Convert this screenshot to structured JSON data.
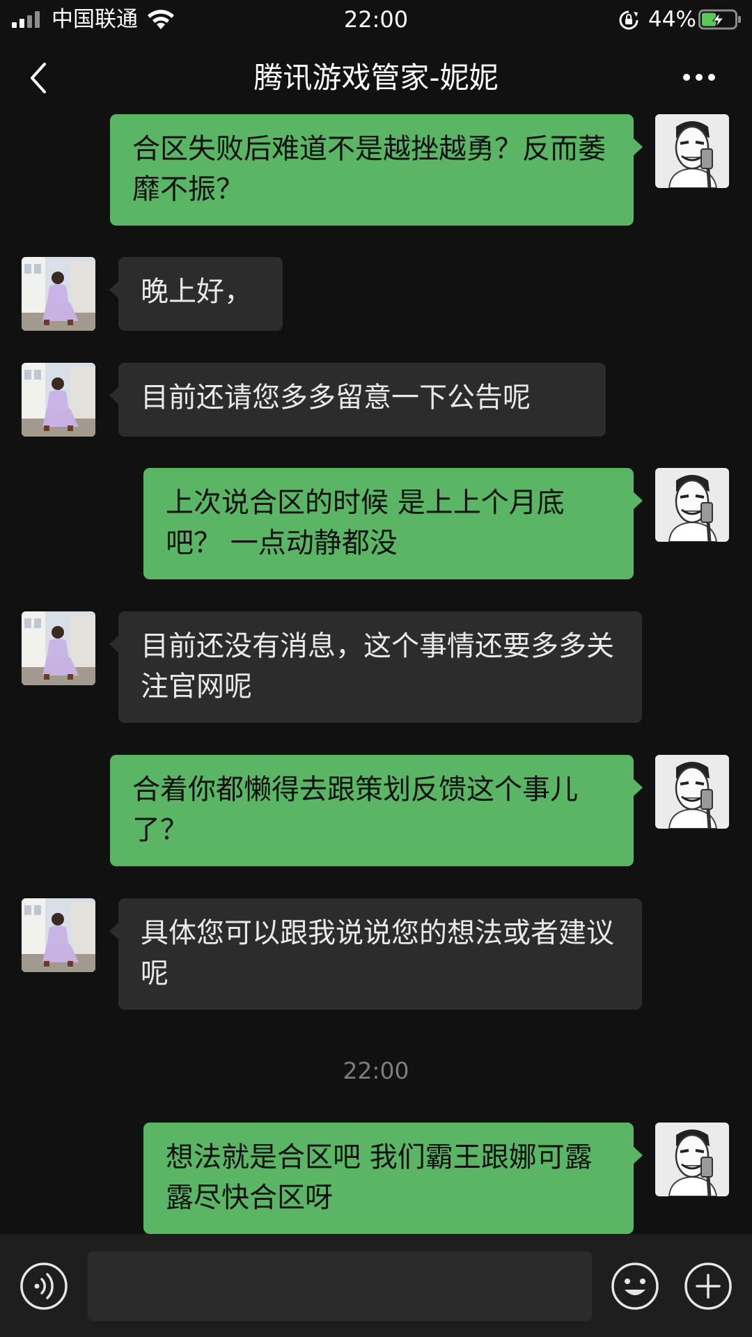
{
  "status_bar": {
    "carrier": "中国联通",
    "time": "22:00",
    "battery_percent": "44%",
    "battery_level": 0.44,
    "icons": [
      "signal-icon",
      "wifi-icon",
      "rotation-lock-icon",
      "battery-charging-icon"
    ]
  },
  "nav": {
    "title": "腾讯游戏管家-妮妮",
    "back_icon": "chevron-left-icon",
    "more_icon": "more-dots-icon"
  },
  "messages": [
    {
      "sender": "me",
      "text": "合区失败后难道不是越挫越勇？反而萎靡不振？"
    },
    {
      "sender": "them",
      "text": "晚上好，"
    },
    {
      "sender": "them",
      "text": "目前还请您多多留意一下公告呢"
    },
    {
      "sender": "me",
      "text": "上次说合区的时候 是上上个月底吧？ 一点动静都没"
    },
    {
      "sender": "them",
      "text": "目前还没有消息，这个事情还要多多关注官网呢"
    },
    {
      "sender": "me",
      "text": "合着你都懒得去跟策划反馈这个事儿了？"
    },
    {
      "sender": "them",
      "text": "具体您可以跟我说说您的想法或者建议呢"
    },
    {
      "sender": "me",
      "text": "想法就是合区吧 我们霸王跟娜可露露尽快合区呀"
    }
  ],
  "time_separator": "22:00",
  "input_bar": {
    "value": "",
    "voice_icon": "voice-icon",
    "emoji_icon": "emoji-icon",
    "plus_icon": "plus-icon"
  },
  "colors": {
    "background": "#111111",
    "my_bubble": "#5ab564",
    "their_bubble": "#2c2c2c",
    "battery_fill": "#5ac85a"
  }
}
